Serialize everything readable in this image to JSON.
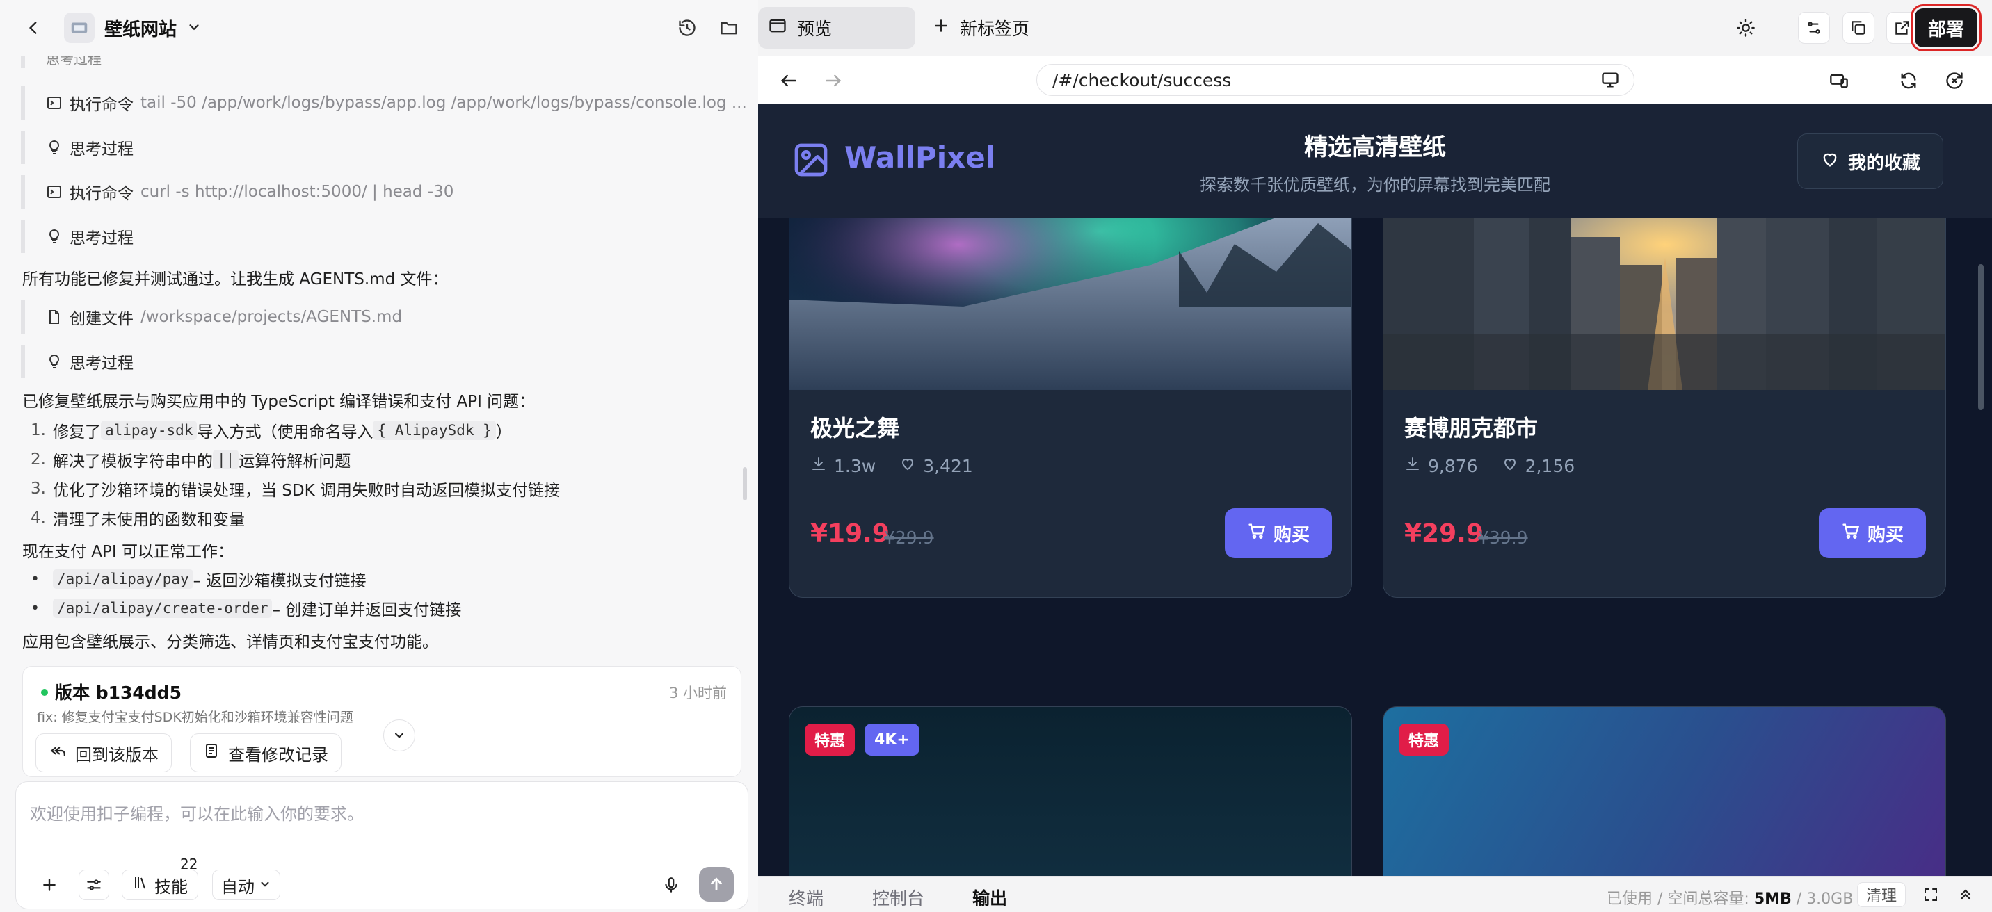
{
  "left": {
    "app_title": "壁纸网站",
    "steps": [
      {
        "type": "cmd",
        "label": "执行命令",
        "detail": "tail -50 /app/work/logs/bypass/app.log /app/work/logs/bypass/console.log ..."
      },
      {
        "type": "think",
        "label": "思考过程",
        "detail": ""
      },
      {
        "type": "cmd",
        "label": "执行命令",
        "detail": "curl -s http://localhost:5000/ | head -30"
      },
      {
        "type": "think",
        "label": "思考过程",
        "detail": ""
      }
    ],
    "msg_all_fixed": "所有功能已修复并测试通过。让我生成 AGENTS.md 文件：",
    "step_create_file": {
      "label": "创建文件",
      "detail": "/workspace/projects/AGENTS.md"
    },
    "step_think_2": "思考过程",
    "summary_intro": "已修复壁纸展示与购买应用中的 TypeScript 编译错误和支付 API 问题：",
    "fixes": [
      {
        "num": "1.",
        "pre": "修复了 ",
        "code": "alipay-sdk",
        "post": " 导入方式（使用命名导入 ",
        "code2": "{ AlipaySdk }",
        "post2": "）"
      },
      {
        "num": "2.",
        "pre": "解决了模板字符串中的 ",
        "code": "||",
        "post": " 运算符解析问题",
        "code2": "",
        "post2": ""
      },
      {
        "num": "3.",
        "pre": "优化了沙箱环境的错误处理，当 SDK 调用失败时自动返回模拟支付链接",
        "code": "",
        "post": "",
        "code2": "",
        "post2": ""
      },
      {
        "num": "4.",
        "pre": "清理了未使用的函数和变量",
        "code": "",
        "post": "",
        "code2": "",
        "post2": ""
      }
    ],
    "api_intro": "现在支付 API 可以正常工作：",
    "apis": [
      {
        "code": "/api/alipay/pay",
        "desc": " – 返回沙箱模拟支付链接"
      },
      {
        "code": "/api/alipay/create-order",
        "desc": " – 创建订单并返回支付链接"
      }
    ],
    "summary_end": "应用包含壁纸展示、分类筛选、详情页和支付宝支付功能。",
    "version": {
      "title": "版本 b134dd5",
      "time": "3 小时前",
      "message": "fix: 修复支付宝支付SDK初始化和沙箱环境兼容性问题",
      "rollback_label": "回到该版本",
      "changes_label": "查看修改记录"
    },
    "input": {
      "placeholder": "欢迎使用扣子编程，可以在此输入你的要求。",
      "skills_label": "技能",
      "skills_count": "22",
      "mode_label": "自动"
    }
  },
  "right": {
    "tab_preview": "预览",
    "tab_new": "新标签页",
    "deploy_label": "部署",
    "url": "/#/checkout/success",
    "site": {
      "brand": "WallPixel",
      "title": "精选高清壁纸",
      "subtitle": "探索数千张优质壁纸，为你的屏幕找到完美匹配",
      "favorites_label": "我的收藏",
      "buy_label": "购买",
      "cards": [
        {
          "name": "极光之舞",
          "downloads": "1.3w",
          "likes": "3,421",
          "price": "¥19.9",
          "original": "¥29.9"
        },
        {
          "name": "赛博朋克都市",
          "downloads": "9,876",
          "likes": "2,156",
          "price": "¥29.9",
          "original": "¥39.9"
        }
      ],
      "tags_card3": [
        "特惠",
        "4K+"
      ],
      "tags_card4": [
        "特惠"
      ]
    },
    "bottom": {
      "tabs": [
        "终端",
        "控制台",
        "输出"
      ],
      "storage_label": "已使用 / 空间总容量:",
      "storage_used": "5MB",
      "storage_total": "3.0GB",
      "clean_label": "清理"
    }
  },
  "colors": {
    "accent": "#6366f1",
    "price": "#f43f5e",
    "deploy_bg": "#18181b",
    "highlight": "#dc2626"
  }
}
